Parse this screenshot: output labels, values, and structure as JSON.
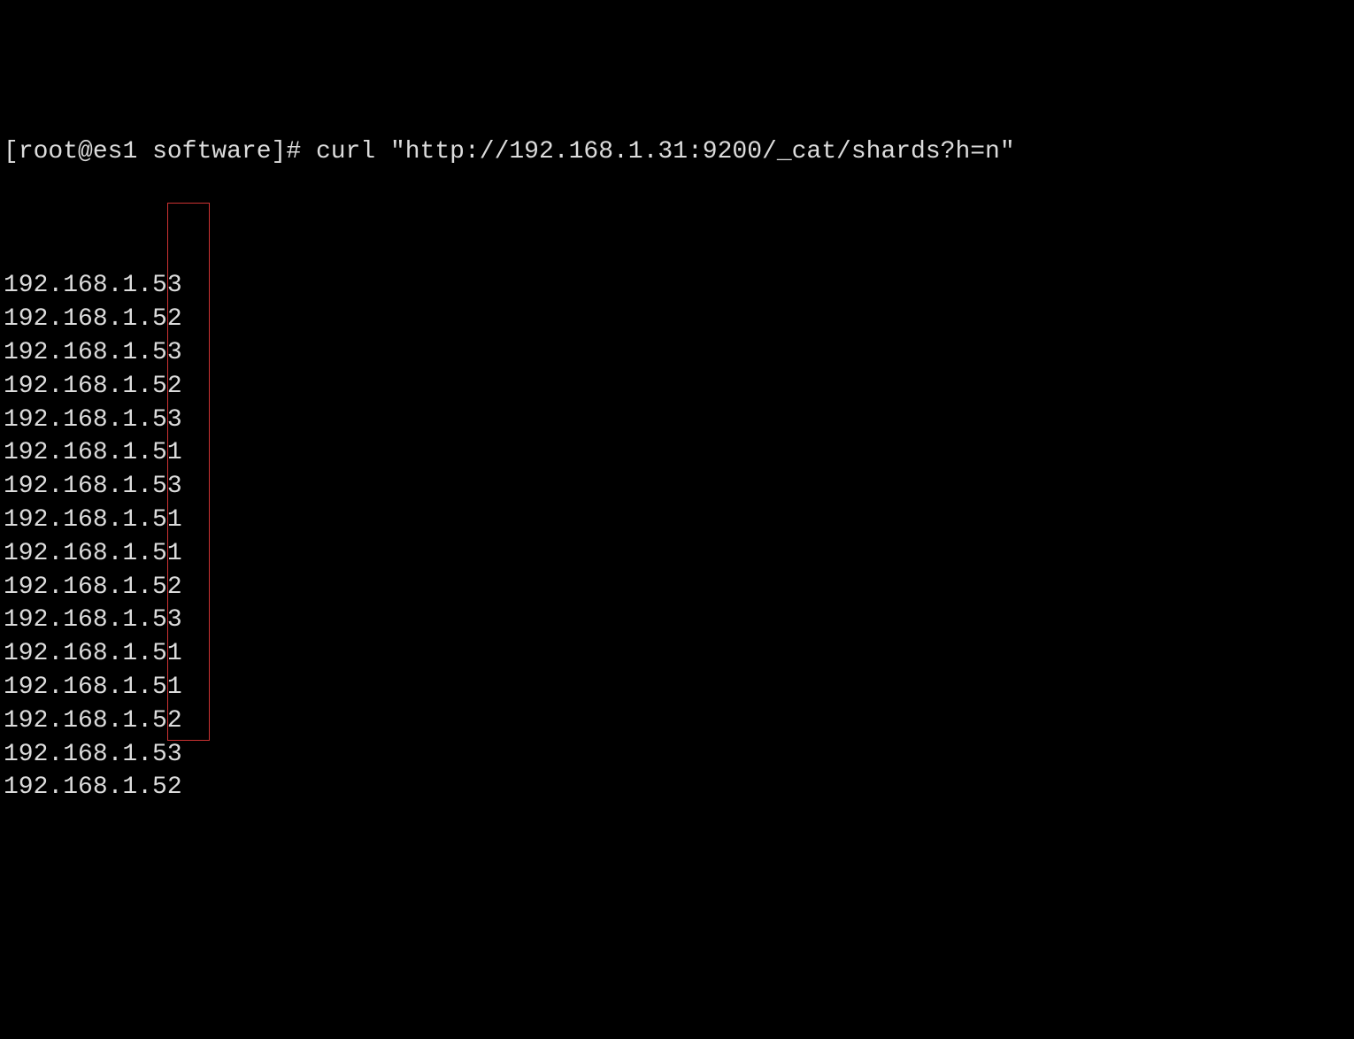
{
  "prompt": {
    "user": "root",
    "host": "es1",
    "directory": "software",
    "symbol": "#",
    "command": "curl \"http://192.168.1.31:9200/_cat/shards?h=n\""
  },
  "output_lines": [
    "192.168.1.53",
    "192.168.1.52",
    "192.168.1.53",
    "192.168.1.52",
    "192.168.1.53",
    "192.168.1.51",
    "192.168.1.53",
    "192.168.1.51",
    "192.168.1.51",
    "192.168.1.52",
    "192.168.1.53",
    "192.168.1.51",
    "192.168.1.51",
    "192.168.1.52",
    "192.168.1.53",
    "192.168.1.52"
  ],
  "partial_prompt_visible": true
}
